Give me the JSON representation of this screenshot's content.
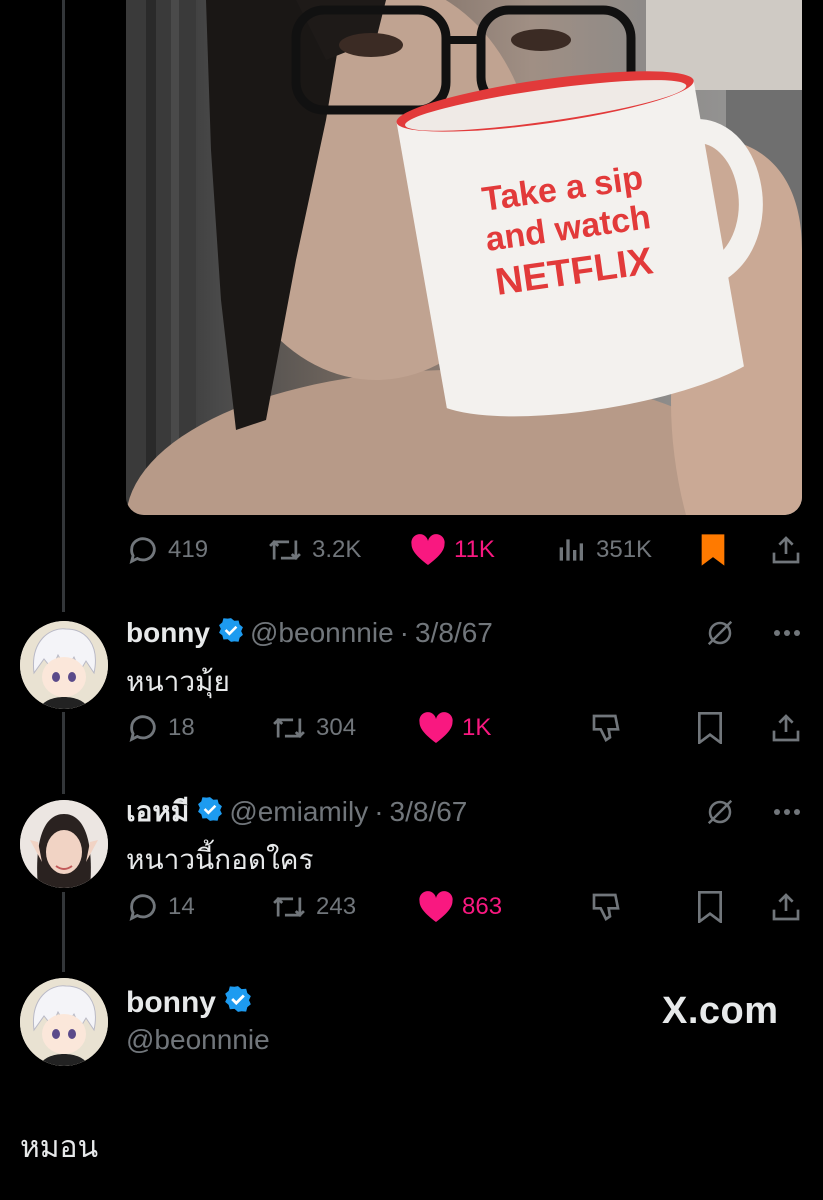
{
  "main_post": {
    "photo_alt_text_visible": "Take a sip and watch NETFLIX",
    "stats": {
      "replies": "419",
      "reposts": "3.2K",
      "likes": "11K",
      "views": "351K"
    },
    "icons": [
      "reply-icon",
      "repost-icon",
      "like-icon",
      "views-icon",
      "bookmark-icon",
      "share-icon"
    ]
  },
  "replies": [
    {
      "name": "bonny",
      "handle": "@beonnnie",
      "separator": "·",
      "date": "3/8/67",
      "text": "หนาวมุ้ย",
      "replies": "18",
      "reposts": "304",
      "likes": "1K"
    },
    {
      "name": "เอหมี",
      "handle": "@emiamily",
      "separator": "·",
      "date": "3/8/67",
      "text": "หนาวนี้กอดใคร",
      "replies": "14",
      "reposts": "243",
      "likes": "863"
    }
  ],
  "focus_post": {
    "name": "bonny",
    "handle": "@beonnnie",
    "brand": "X.com",
    "text": "หมอน"
  },
  "colors": {
    "background": "#000000",
    "text": "#e7e9ea",
    "muted": "#71767b",
    "like": "#f91880",
    "verified": "#1d9bf0",
    "bookmark_active": "#ff7a00"
  }
}
